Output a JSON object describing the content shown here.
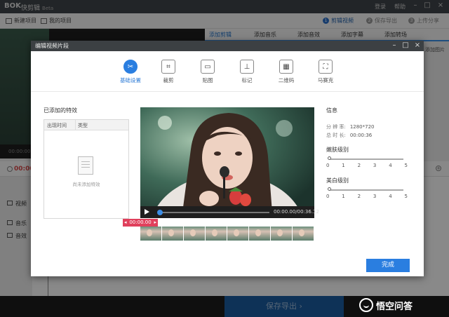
{
  "app": {
    "logo": "BOK",
    "title": "快剪辑",
    "beta": "Beta",
    "login": "登录",
    "help": "帮助",
    "toolbar": {
      "new_project": "新建项目",
      "my_projects": "我的项目"
    },
    "steps": [
      {
        "num": "1",
        "label": "剪辑视频"
      },
      {
        "num": "2",
        "label": "保存导出"
      },
      {
        "num": "3",
        "label": "上传分享"
      }
    ],
    "tabs": [
      "添加剪辑",
      "添加音乐",
      "添加音效",
      "添加字幕",
      "添加转场"
    ],
    "side_text": "添加图片",
    "preview_time": "00:00:00",
    "ruler_time": "00:00",
    "tracks": {
      "video": "视频",
      "music": "音乐",
      "effect": "音效"
    },
    "export_button": "保存导出",
    "export_arrow": "›"
  },
  "watermark": "悟空问答",
  "dialog": {
    "title": "编辑视频片段",
    "functions": [
      {
        "label": "基础设置",
        "icon": "scissors-icon",
        "glyph": "✂",
        "active": true
      },
      {
        "label": "裁剪",
        "icon": "crop-icon",
        "glyph": "⌗",
        "active": false
      },
      {
        "label": "贴图",
        "icon": "image-icon",
        "glyph": "▭",
        "active": false
      },
      {
        "label": "标记",
        "icon": "pin-icon",
        "glyph": "⊥",
        "active": false
      },
      {
        "label": "二维码",
        "icon": "qrcode-icon",
        "glyph": "▦",
        "active": false
      },
      {
        "label": "马赛克",
        "icon": "mosaic-icon",
        "glyph": "⛶",
        "active": false
      }
    ],
    "effects": {
      "title": "已添加的特效",
      "col_time": "出现时间",
      "col_type": "类型",
      "empty": "尚未添加特效"
    },
    "player": {
      "time": "00:00.00/00:36.12",
      "progress": 0.0
    },
    "marker": {
      "time": "00:00.00",
      "left": "◂",
      "right": "▸"
    },
    "info": {
      "title": "信息",
      "resolution_label": "分 辨 率:",
      "resolution": "1280*720",
      "duration_label": "总 时 长:",
      "duration": "00:00:36"
    },
    "sliders": [
      {
        "label": "嫩肤级别",
        "value": 0,
        "ticks": [
          "0",
          "1",
          "2",
          "3",
          "4",
          "5"
        ]
      },
      {
        "label": "美白级别",
        "value": 0,
        "ticks": [
          "0",
          "1",
          "2",
          "3",
          "4",
          "5"
        ]
      }
    ],
    "ok": "完成"
  }
}
